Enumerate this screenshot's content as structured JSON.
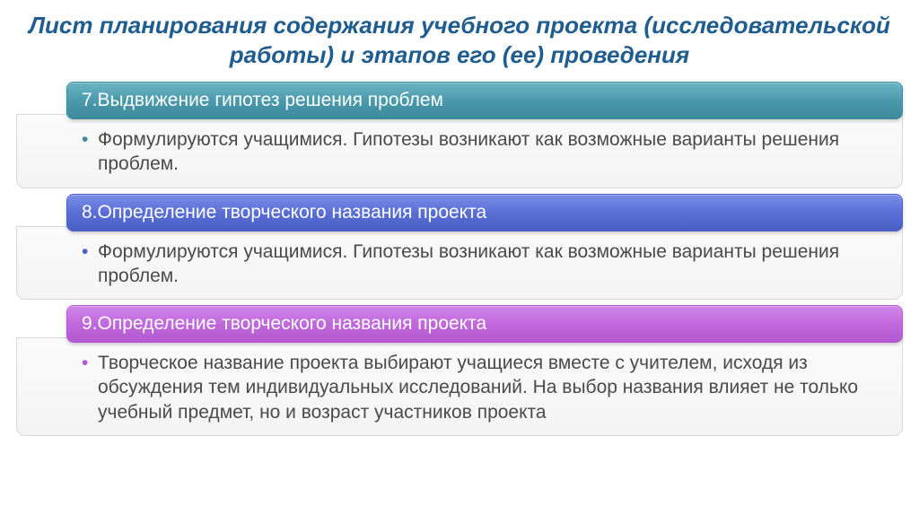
{
  "title": "Лист планирования содержания учебного проекта (исследовательской работы) и этапов его (ее) проведения",
  "sections": [
    {
      "header": "7.Выдвижение гипотез решения проблем",
      "body": "Формулируются учащимися. Гипотезы возникают как возможные варианты решения проблем."
    },
    {
      "header": "8.Определение творческого названия проекта",
      "body": "Формулируются учащимися. Гипотезы возникают как возможные варианты решения проблем."
    },
    {
      "header": "9.Определение творческого названия проекта",
      "body": "Творческое название проекта выбирают учащиеся вместе с учителем, исходя из обсуждения тем индивидуальных исследований. На выбор названия влияет не только учебный предмет, но и возраст участников проекта"
    }
  ]
}
